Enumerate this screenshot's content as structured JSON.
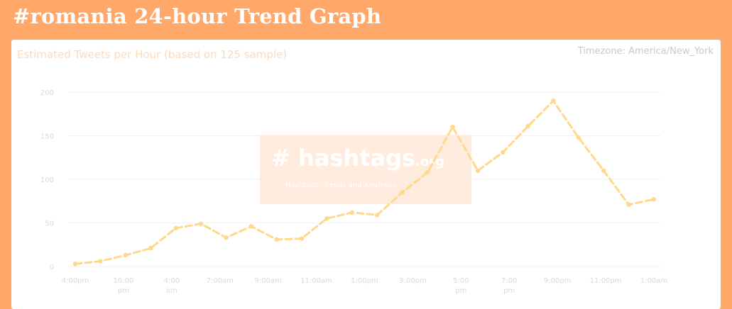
{
  "page": {
    "title": "#romania 24-hour Trend Graph"
  },
  "chart_header": {
    "subtitle": "Estimated Tweets per Hour (based on 125 sample)",
    "timezone": "Timezone: America/New_York"
  },
  "watermark": {
    "logo_text": "# hashtags",
    "logo_suffix": ".org",
    "tagline": "Hashtags, Trends and Analytics"
  },
  "colors": {
    "background": "#ffa869",
    "line": "#ffd88a",
    "gridline": "#f2f2f2",
    "axis_text": "#d9d9d9"
  },
  "chart_data": {
    "type": "line",
    "title": "",
    "xlabel": "",
    "ylabel": "",
    "ylim": [
      0,
      200
    ],
    "yticks": [
      "0",
      "50",
      "100",
      "150",
      "200"
    ],
    "grid": true,
    "x_labels": [
      "4:00pm",
      "",
      "10:00 pm",
      "",
      "4:00 am",
      "",
      "7:00am",
      "",
      "9:00am",
      "",
      "11:00am",
      "",
      "1:00pm",
      "",
      "3:00pm",
      "",
      "5:00 pm",
      "",
      "7:00 pm",
      "",
      "9:00pm",
      "",
      "11:00pm",
      "",
      "1:00am"
    ],
    "series": [
      {
        "values": [
          3,
          6,
          13,
          21,
          44,
          49,
          33,
          46,
          31,
          32,
          55,
          62,
          59,
          85,
          108,
          160,
          110,
          131,
          161,
          190,
          148,
          110,
          71,
          77
        ]
      }
    ]
  }
}
